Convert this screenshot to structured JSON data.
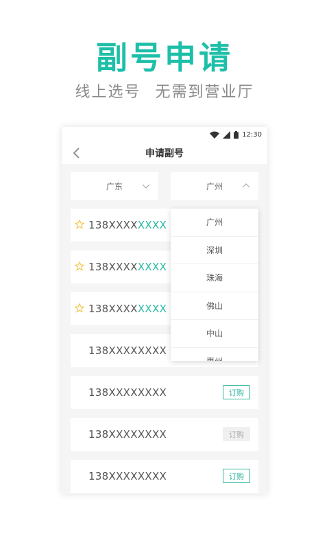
{
  "promo": {
    "title": "副号申请",
    "subtitle_left": "线上选号",
    "subtitle_right": "无需到营业厅"
  },
  "statusbar": {
    "time": "12:30"
  },
  "appbar": {
    "title": "申请副号",
    "back_icon": "chevron-left-icon"
  },
  "filters": {
    "province": {
      "value": "广东",
      "icon": "chevron-down-icon"
    },
    "city": {
      "value": "广州",
      "icon": "chevron-up-icon"
    }
  },
  "city_options": [
    "广州",
    "深圳",
    "珠海",
    "佛山",
    "中山",
    "惠州"
  ],
  "numbers": [
    {
      "prefix": "138XXXX",
      "highlight": "XXXX",
      "favorite": true
    },
    {
      "prefix": "138XXXX",
      "highlight": "XXXX",
      "favorite": true
    },
    {
      "prefix": "138XXXX",
      "highlight": "XXXX",
      "favorite": true
    },
    {
      "prefix": "138XXXXXXXX",
      "highlight": "",
      "favorite": false
    },
    {
      "prefix": "138XXXXXXXX",
      "highlight": "",
      "favorite": false,
      "order_label": "订购",
      "order_enabled": true
    },
    {
      "prefix": "138XXXXXXXX",
      "highlight": "",
      "favorite": false,
      "order_label": "订购",
      "order_enabled": false
    },
    {
      "prefix": "138XXXXXXXX",
      "highlight": "",
      "favorite": false,
      "order_label": "订购",
      "order_enabled": true
    }
  ],
  "colors": {
    "accent": "#1dbfa8",
    "star": "#f3c340",
    "muted": "#8a8a8a"
  }
}
